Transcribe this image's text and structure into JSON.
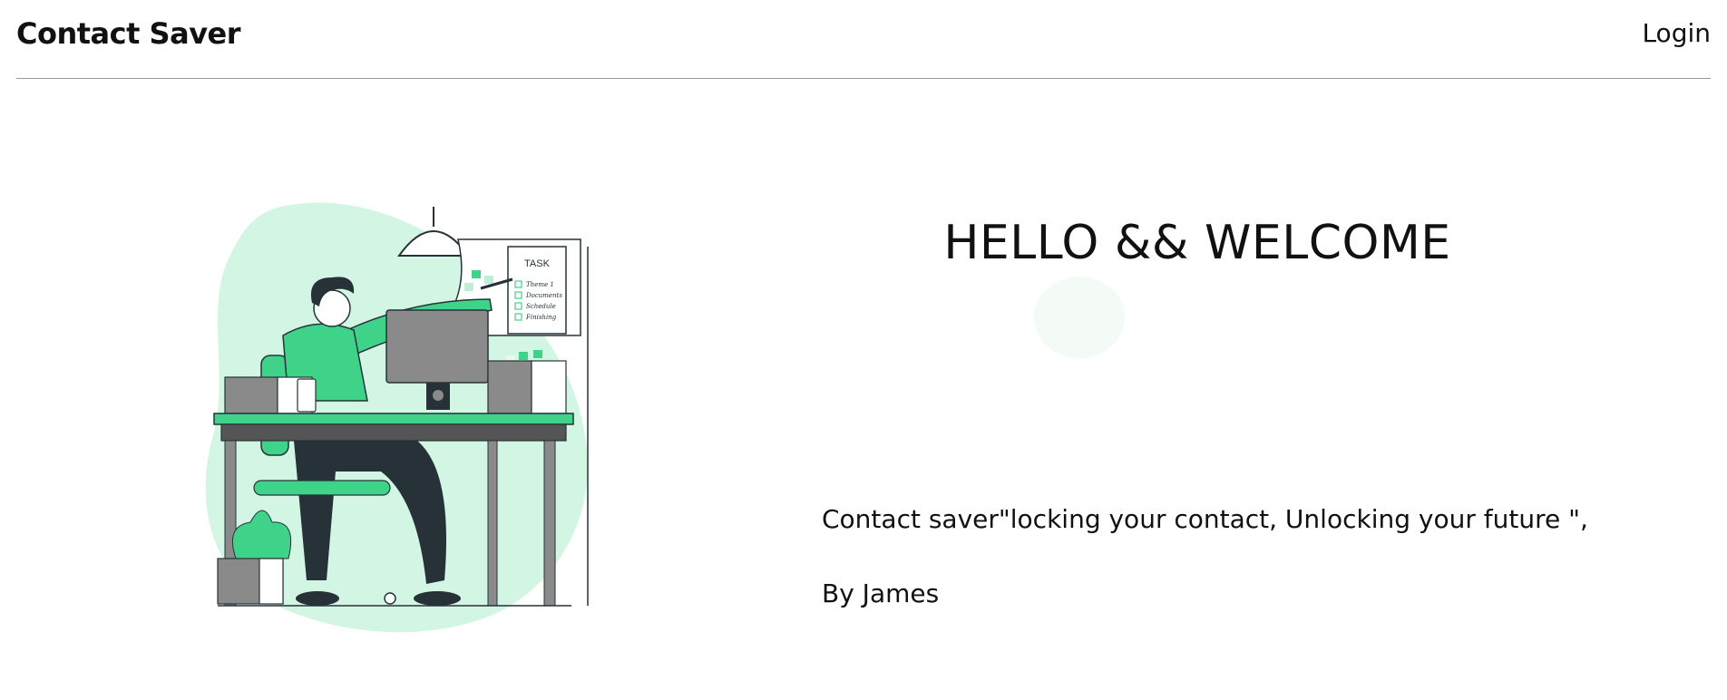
{
  "nav": {
    "brand": "Contact Saver",
    "login_label": "Login"
  },
  "hero": {
    "title": "HELLO && WELCOME",
    "tagline": "Contact saver\"locking your contact, Unlocking your future \",",
    "byline": "By James"
  },
  "illustration": {
    "task_note_title": "TASK",
    "task_items": [
      "Theme 1",
      "Documents",
      "Schedule",
      "Finishing"
    ]
  },
  "colors": {
    "accent_green": "#3fd38a",
    "light_green": "#d3f5e4",
    "dark": "#263238",
    "divider": "#9a9a9a"
  }
}
